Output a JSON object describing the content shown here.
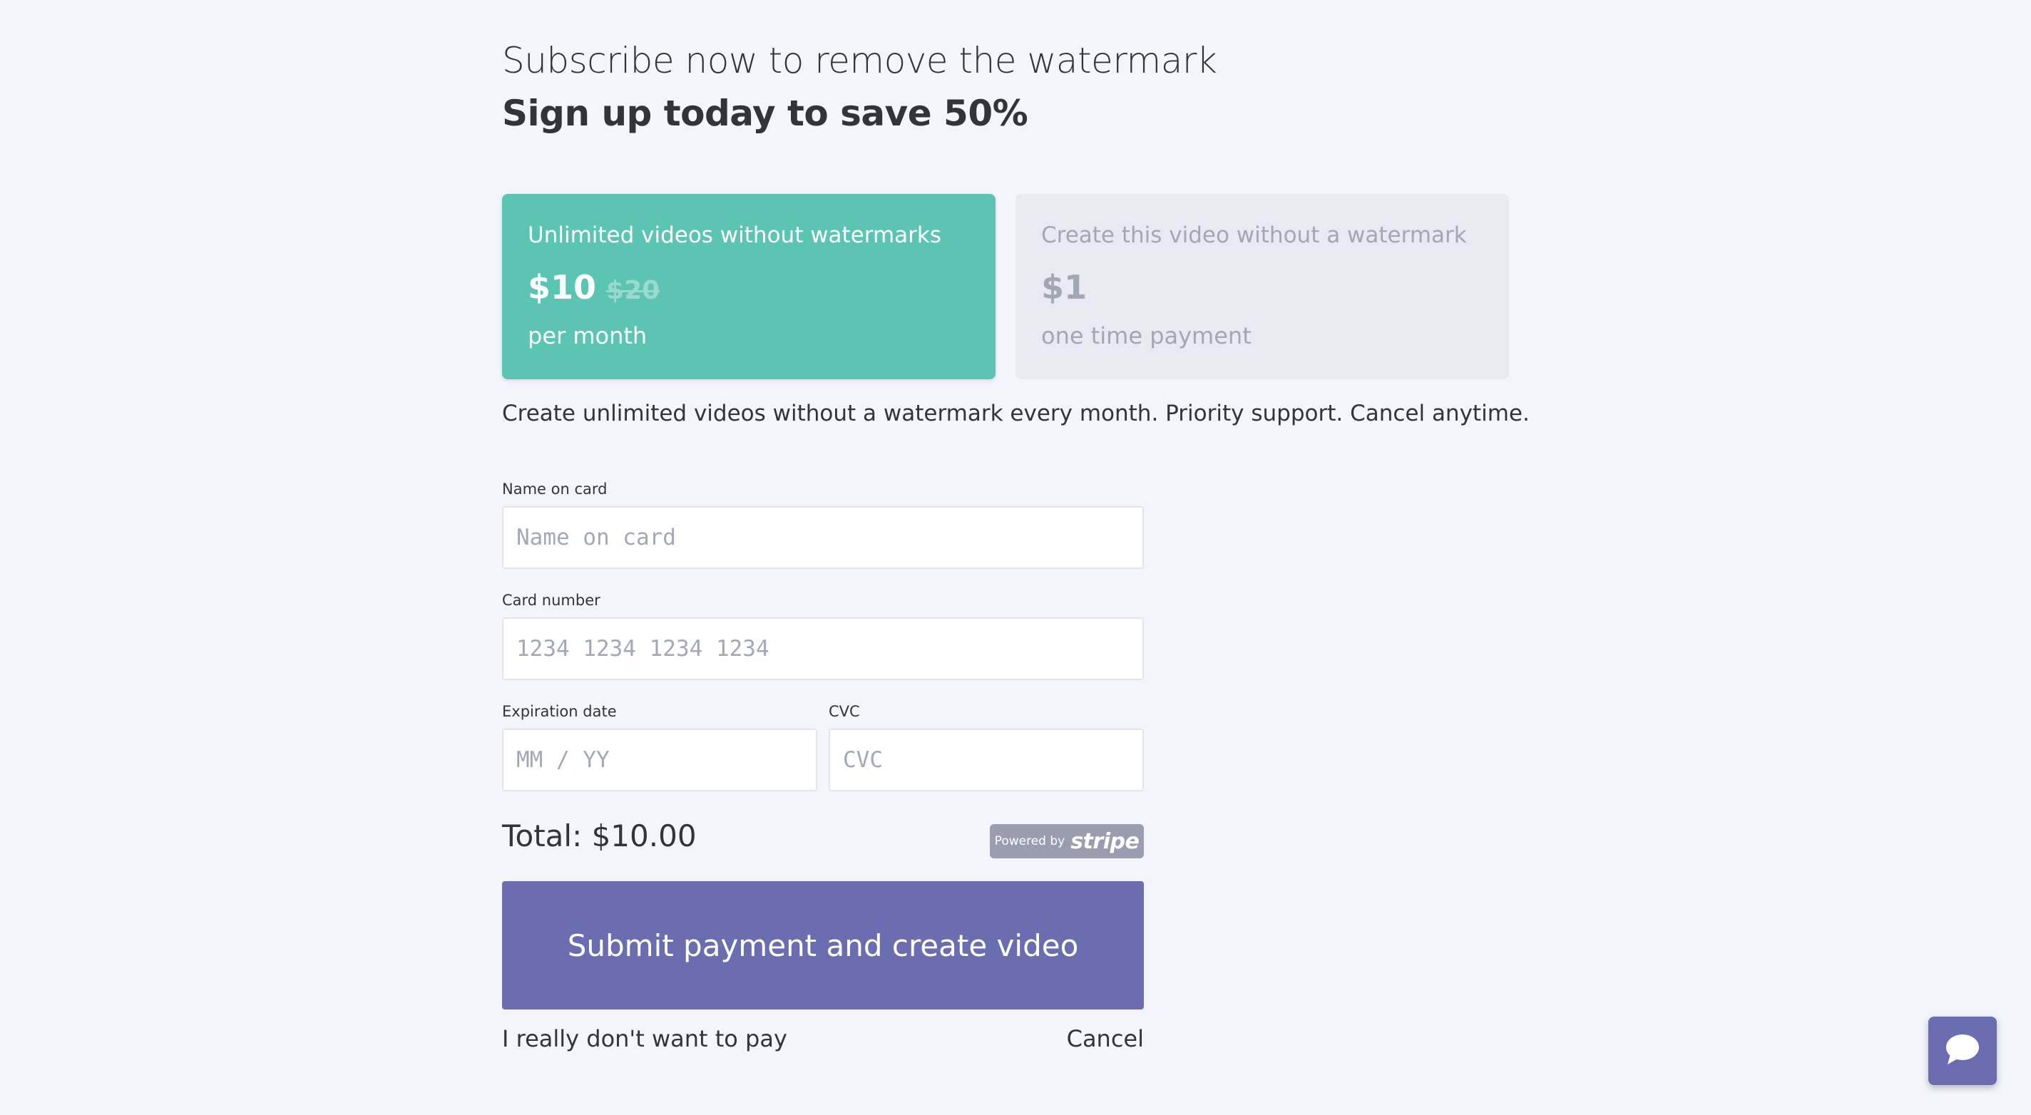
{
  "header": {
    "headline": "Subscribe now to remove the watermark",
    "subheadline": "Sign up today to save 50%"
  },
  "plans": [
    {
      "title": "Unlimited videos without watermarks",
      "price": "$10",
      "old_price": "$20",
      "period": "per month",
      "selected": true
    },
    {
      "title": "Create this video without a watermark",
      "price": "$1",
      "period": "one time payment",
      "selected": false
    }
  ],
  "description": "Create unlimited videos without a watermark every month. Priority support. Cancel anytime.",
  "form": {
    "name_label": "Name on card",
    "name_placeholder": "Name on card",
    "name_value": "",
    "card_label": "Card number",
    "card_placeholder": "1234 1234 1234 1234",
    "card_value": "",
    "expiry_label": "Expiration date",
    "expiry_placeholder": "MM / YY",
    "expiry_value": "",
    "cvc_label": "CVC",
    "cvc_placeholder": "CVC",
    "cvc_value": ""
  },
  "total": "Total: $10.00",
  "stripe_badge": {
    "powered_by": "Powered by",
    "brand": "stripe"
  },
  "submit_label": "Submit payment and create video",
  "decline_link": "I really don't want to pay",
  "cancel_link": "Cancel",
  "chat": {
    "icon": "chat-bubble-icon"
  },
  "colors": {
    "background": "#f4f5fc",
    "selected_plan": "#5bc4b2",
    "unselected_plan": "#e8eaf2",
    "primary_button": "#6b6db1",
    "text": "#33333a"
  }
}
